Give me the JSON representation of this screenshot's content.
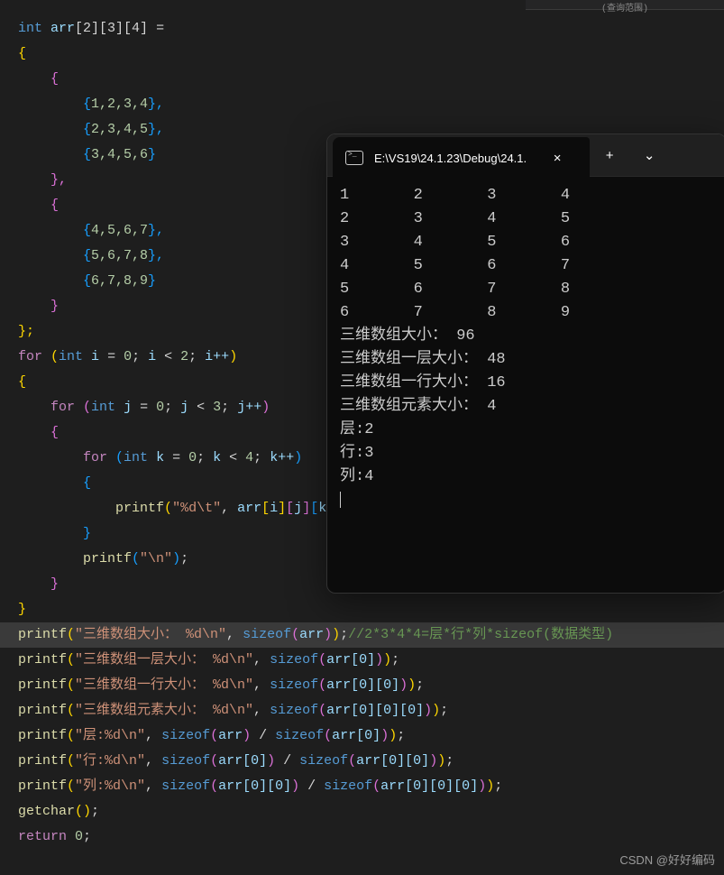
{
  "tab_area_hint": "(查询范围)",
  "code": {
    "l1_int": "int",
    "l1_arr": "arr",
    "l1_dims": "[2][3][4]",
    "l1_eq": " =",
    "l2": "{",
    "l3": "    {",
    "l4_o": "        {",
    "l4_v": "1,2,3,4",
    "l4_c": "},",
    "l5_o": "        {",
    "l5_v": "2,3,4,5",
    "l5_c": "},",
    "l6_o": "        {",
    "l6_v": "3,4,5,6",
    "l6_c": "}",
    "l7": "    },",
    "l8": "    {",
    "l9_o": "        {",
    "l9_v": "4,5,6,7",
    "l9_c": "},",
    "l10_o": "        {",
    "l10_v": "5,6,7,8",
    "l10_c": "},",
    "l11_o": "        {",
    "l11_v": "6,7,8,9",
    "l11_c": "}",
    "l12": "    }",
    "l13": "};",
    "for1": "for",
    "for1_open": " (",
    "for1_int": "int",
    "for1_i": " i",
    "for1_eq": " = ",
    "for1_z": "0",
    "for1_sc": "; ",
    "for1_cond": "i < 2",
    "for1_sc2": "; ",
    "for1_inc": "i++",
    "for1_cl": ")",
    "for2": "for",
    "for2_open": " (",
    "for2_int": "int",
    "for2_j": " j",
    "for2_eq": " = ",
    "for2_z": "0",
    "for2_sc": "; ",
    "for2_cond": "j < 3",
    "for2_sc2": "; ",
    "for2_inc": "j++",
    "for2_cl": ")",
    "for3": "for",
    "for3_open": " (",
    "for3_int": "int",
    "for3_k": " k",
    "for3_eq": " = ",
    "for3_z": "0",
    "for3_sc": "; ",
    "for3_cond": "k < 4",
    "for3_sc2": "; ",
    "for3_inc": "k++",
    "for3_cl": ")",
    "printf": "printf",
    "printf_it": "\"%d\\t\"",
    "printf_arg": "arr",
    "printf_i": "i",
    "printf_j": "j",
    "printf_k": "k",
    "printf_nl": "\"\\n\"",
    "p1_str": "\"三维数组大小： %d\\n\"",
    "p1_fn": "sizeof",
    "p1_arg": "arr",
    "p1_cmt": "//2*3*4*4=层*行*列*sizeof(数据类型)",
    "p2_str": "\"三维数组一层大小： %d\\n\"",
    "p2_arg": "arr[0]",
    "p3_str": "\"三维数组一行大小： %d\\n\"",
    "p3_arg": "arr[0][0]",
    "p4_str": "\"三维数组元素大小： %d\\n\"",
    "p4_arg": "arr[0][0][0]",
    "p5_str": "\"层:%d\\n\"",
    "p5_a": "arr",
    "p5_b": "arr[0]",
    "p6_str": "\"行:%d\\n\"",
    "p6_a": "arr[0]",
    "p6_b": "arr[0][0]",
    "p7_str": "\"列:%d\\n\"",
    "p7_a": "arr[0][0]",
    "p7_b": "arr[0][0][0]",
    "getchar": "getchar",
    "return": "return",
    "zero": "0",
    "semi": ";",
    "div": " / ",
    "comma": ", ",
    "op_brace": "{",
    "cl_brace": "}"
  },
  "terminal": {
    "title": "E:\\VS19\\24.1.23\\Debug\\24.1.",
    "close_icon": "×",
    "new_icon": "+",
    "drop_icon": "⌄",
    "rows": [
      "1       2       3       4",
      "2       3       4       5",
      "3       4       5       6",
      "4       5       6       7",
      "5       6       7       8",
      "6       7       8       9",
      "三维数组大小： 96",
      "三维数组一层大小： 48",
      "三维数组一行大小： 16",
      "三维数组元素大小： 4",
      "层:2",
      "行:3",
      "列:4"
    ]
  },
  "watermark": "CSDN @好好编码"
}
